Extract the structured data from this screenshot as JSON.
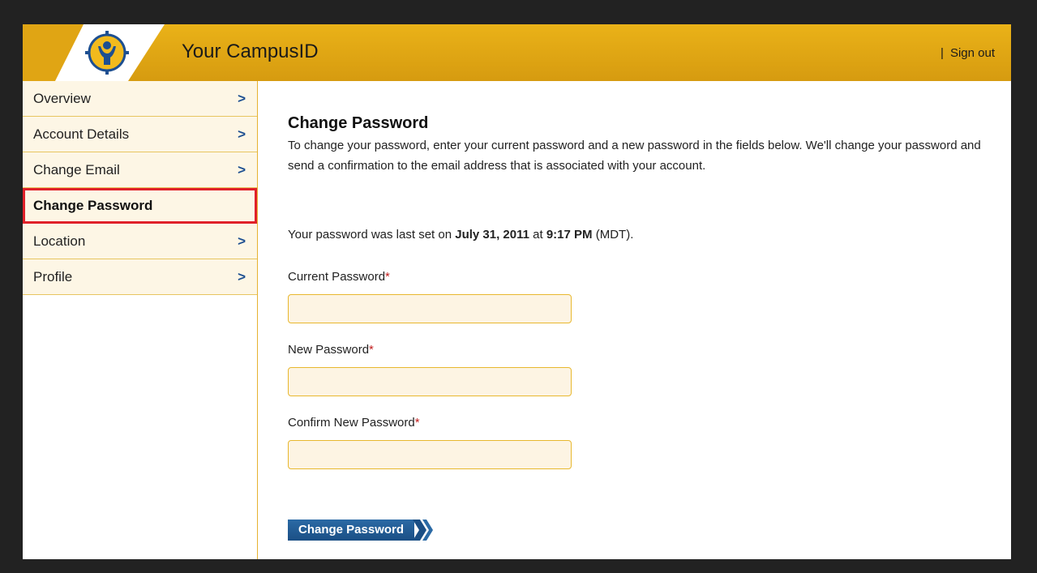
{
  "header": {
    "app_title": "Your CampusID",
    "separator": "|",
    "sign_out": "Sign out",
    "logo_icon": "campus-person-logo",
    "colors": {
      "header_gold": "#eab218",
      "logo_blue": "#1d4f91"
    }
  },
  "sidebar": {
    "items": [
      {
        "label": "Overview",
        "chevron": ">"
      },
      {
        "label": "Account Details",
        "chevron": ">"
      },
      {
        "label": "Change Email",
        "chevron": ">"
      },
      {
        "label": "Change Password",
        "chevron": "",
        "active": true
      },
      {
        "label": "Location",
        "chevron": ">"
      },
      {
        "label": "Profile",
        "chevron": ">"
      }
    ]
  },
  "main": {
    "title": "Change Password",
    "intro": "To change your password, enter your current password and a new password in the fields below. We'll change your password and send a confirmation to the email address that is associated with your account.",
    "last_set_prefix": "Your password was last set on ",
    "last_set_date": "July 31, 2011",
    "last_set_mid": " at ",
    "last_set_time": "9:17 PM",
    "last_set_suffix": " (MDT).",
    "fields": {
      "current": {
        "label": "Current Password",
        "required": "*",
        "value": ""
      },
      "new": {
        "label": "New Password",
        "required": "*",
        "value": ""
      },
      "confirm": {
        "label": "Confirm New Password",
        "required": "*",
        "value": ""
      }
    },
    "submit_label": "Change Password",
    "submit_color": "#1b4f85"
  }
}
